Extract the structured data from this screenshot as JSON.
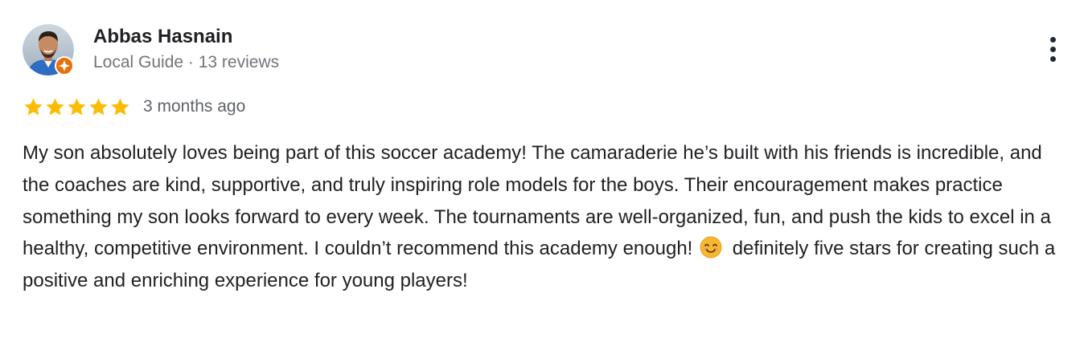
{
  "reviewer": {
    "name": "Abbas Hasnain",
    "meta": "Local Guide · 13 reviews",
    "badge": "local-guide-badge"
  },
  "rating": {
    "stars": 5,
    "max": 5,
    "color": "#fbbc04"
  },
  "review": {
    "time": "3 months ago",
    "text_before_emoji": "My son absolutely loves being part of this soccer academy! The camaraderie he’s built with his friends is incredible, and the coaches are kind, supportive, and truly inspiring role models for the boys. Their encouragement makes practice something my son looks forward to every week. The tournaments are well-organized, fun, and push the kids to excel in a healthy, competitive environment. I couldn’t recommend this academy enough!",
    "emoji": "smiling-face-icon",
    "text_after_emoji": "definitely five stars for creating such a positive and enriching experience for young players!"
  },
  "menu": {
    "icon": "more-vertical-icon"
  },
  "colors": {
    "badge_orange": "#e8710a",
    "name_text": "#202124",
    "meta_text": "#70757a",
    "menu_dots": "#1f2a37"
  }
}
